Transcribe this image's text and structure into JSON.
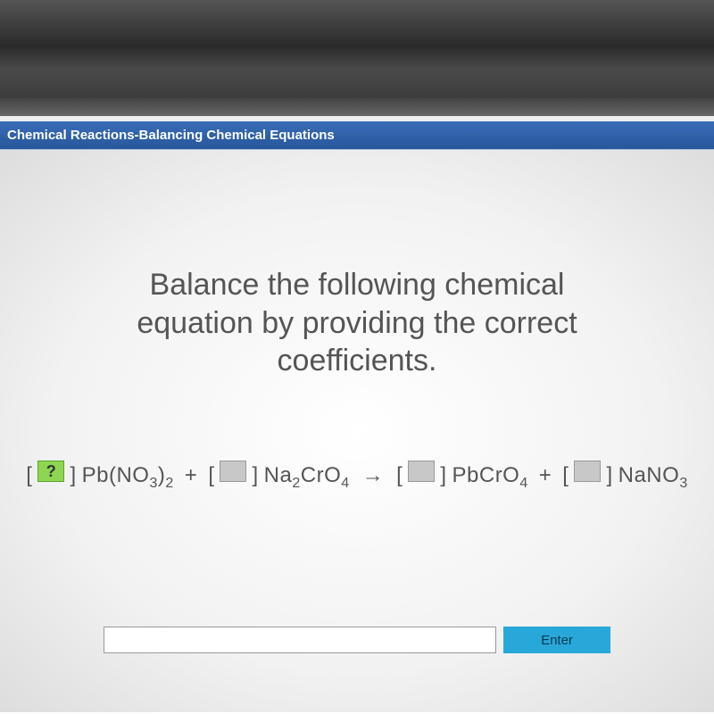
{
  "titlebar": {
    "title": "Chemical Reactions-Balancing Chemical Equations"
  },
  "instruction": {
    "line1": "Balance the following chemical",
    "line2": "equation by providing the correct",
    "line3": "coefficients."
  },
  "equation": {
    "coef1_active": true,
    "species1_main": "Pb(NO",
    "species1_sub1": "3",
    "species1_mid": ")",
    "species1_sub2": "2",
    "plus1": "+",
    "species2_main": "Na",
    "species2_sub1": "2",
    "species2_mid": "CrO",
    "species2_sub2": "4",
    "arrow": "→",
    "species3_main": "PbCrO",
    "species3_sub1": "4",
    "plus2": "+",
    "species4_main": "NaNO",
    "species4_sub1": "3"
  },
  "input": {
    "value": "",
    "placeholder": ""
  },
  "buttons": {
    "enter": "Enter"
  }
}
